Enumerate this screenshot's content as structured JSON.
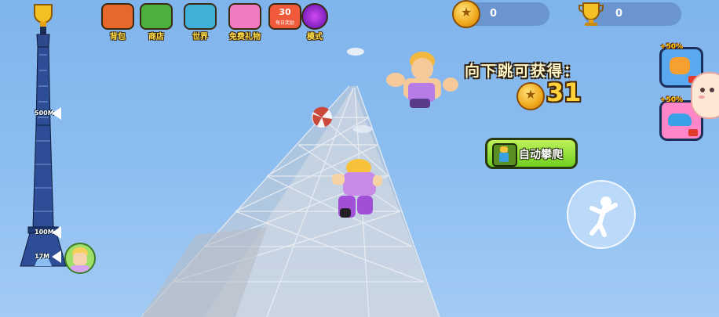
{
  "menu": {
    "items": [
      {
        "label": "背包",
        "icon": "backpack-icon",
        "color": "#e8672a"
      },
      {
        "label": "商店",
        "icon": "shop-cart-icon",
        "color": "#4caf3e"
      },
      {
        "label": "世界",
        "icon": "world-map-icon",
        "color": "#3fb0d8"
      },
      {
        "label": "免费礼物",
        "icon": "gift-box-icon",
        "color": "#f27ac0"
      },
      {
        "label": "每日奖励",
        "icon": "calendar-icon",
        "color": "#f05a3a"
      },
      {
        "label": "模式",
        "icon": "portal-icon",
        "color": "#8a2cd8"
      }
    ],
    "calendar_number": "30",
    "calendar_caption": "每日奖励"
  },
  "stats": {
    "coins": "0",
    "trophies": "0"
  },
  "tower": {
    "markers": [
      "500M",
      "100M",
      "17M"
    ]
  },
  "reward": {
    "label": "向下跳可获得：",
    "value": "31"
  },
  "auto_climb": {
    "label": "自动攀爬"
  },
  "boosts": [
    {
      "pct": "+50%",
      "icon": "strength-boost-icon",
      "color": "#f5a030"
    },
    {
      "pct": "+50%",
      "icon": "speed-shoe-icon",
      "color": "#ff86c8"
    }
  ],
  "colors": {
    "sky": "#8cbdf0",
    "tower_steel": "#c9cdd3",
    "coin": "#f0a81c",
    "auto_button": "#6fcf1f"
  }
}
